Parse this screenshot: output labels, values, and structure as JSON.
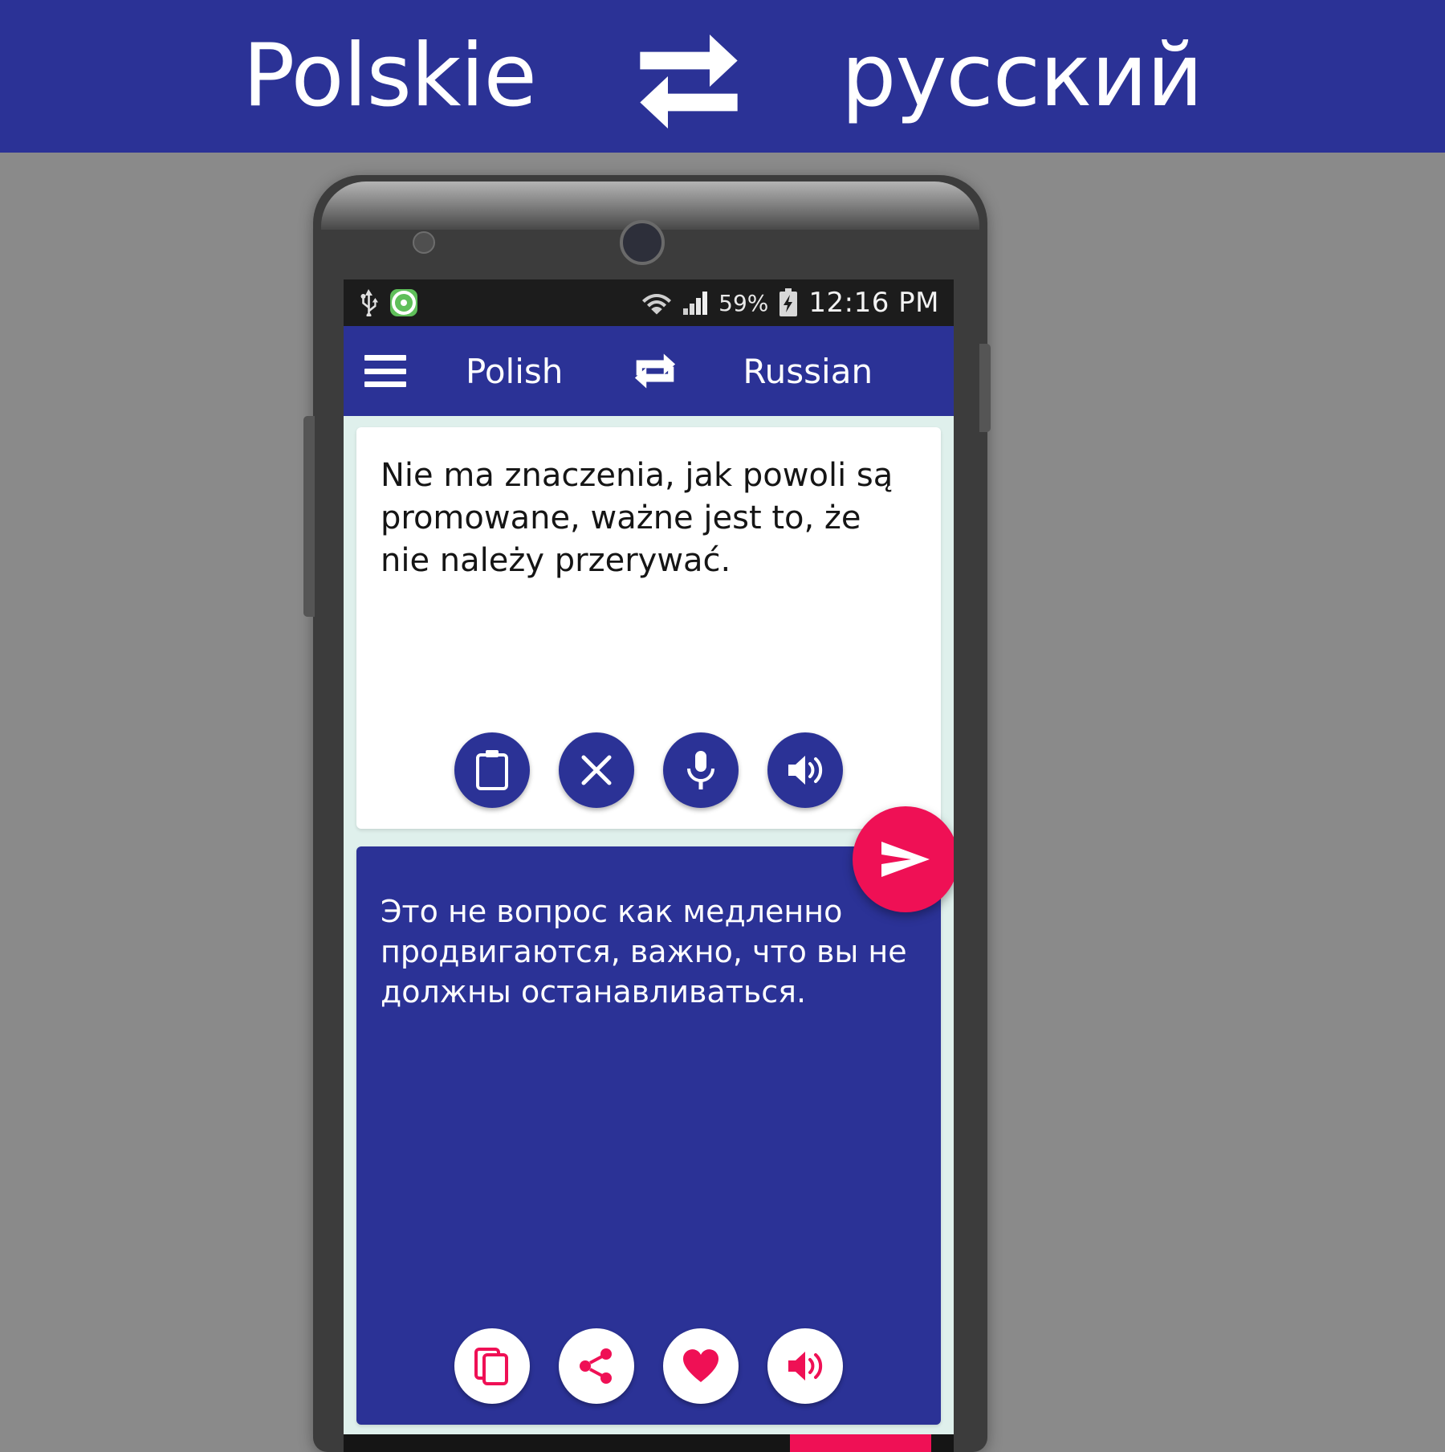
{
  "banner": {
    "source_language": "Polskie",
    "target_language": "русский",
    "swap_icon": "swap-arrows-icon",
    "background_color": "#2b3296",
    "text_color": "#ffffff"
  },
  "phone": {
    "status_bar": {
      "usb_icon": "usb-icon",
      "app_notification_icon": "app-notification-icon",
      "wifi_icon": "wifi-icon",
      "signal_icon": "cellular-signal-icon",
      "battery_percent": "59%",
      "battery_icon": "battery-charging-icon",
      "clock": "12:16 PM",
      "background_color": "#1c1c1c"
    },
    "toolbar": {
      "menu_icon": "hamburger-menu-icon",
      "source_language": "Polish",
      "swap_icon": "swap-languages-icon",
      "target_language": "Russian",
      "background_color": "#2b3296"
    },
    "input_card": {
      "text": "Nie ma znaczenia, jak powoli są promowane, ważne jest to, że nie należy przerywać.",
      "buttons": [
        {
          "name": "paste-button",
          "icon": "clipboard-icon"
        },
        {
          "name": "clear-button",
          "icon": "close-x-icon"
        },
        {
          "name": "voice-input-button",
          "icon": "microphone-icon"
        },
        {
          "name": "speak-source-button",
          "icon": "speaker-icon"
        }
      ],
      "background_color": "#ffffff"
    },
    "send_button": {
      "icon": "send-paper-plane-icon",
      "color": "#ef1055"
    },
    "output_card": {
      "text": "Это не вопрос как медленно продвигаются, важно, что вы не должны останавливаться.",
      "buttons": [
        {
          "name": "copy-button",
          "icon": "copy-icon"
        },
        {
          "name": "share-button",
          "icon": "share-icon"
        },
        {
          "name": "favorite-button",
          "icon": "heart-icon"
        },
        {
          "name": "speak-translation-button",
          "icon": "speaker-icon"
        }
      ],
      "background_color": "#2b3296",
      "text_color": "#ffffff"
    }
  }
}
